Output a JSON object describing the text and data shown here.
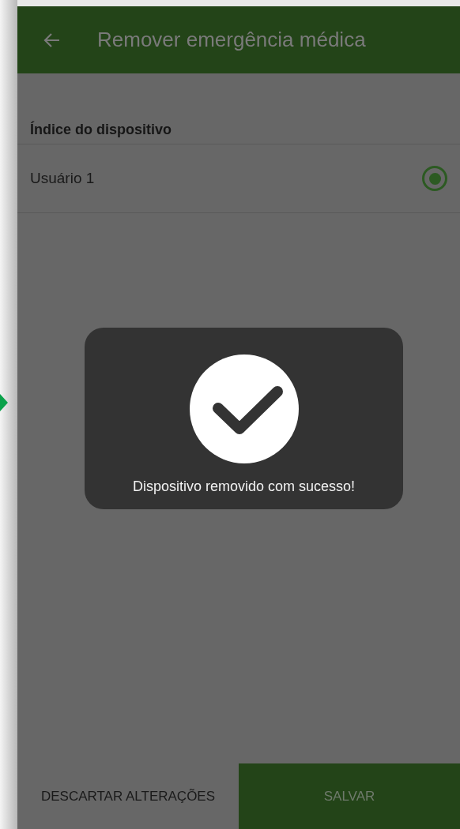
{
  "header": {
    "title": "Remover emergência médica"
  },
  "section": {
    "label": "Índice do dispositivo"
  },
  "options": [
    {
      "label": "Usuário 1",
      "selected": true
    }
  ],
  "toast": {
    "message": "Dispositivo removido com sucesso!"
  },
  "buttons": [
    {
      "label": "DESCARTAR ALTERAÇÕES",
      "kind": "secondary"
    },
    {
      "label": "SALVAR",
      "kind": "primary"
    }
  ]
}
